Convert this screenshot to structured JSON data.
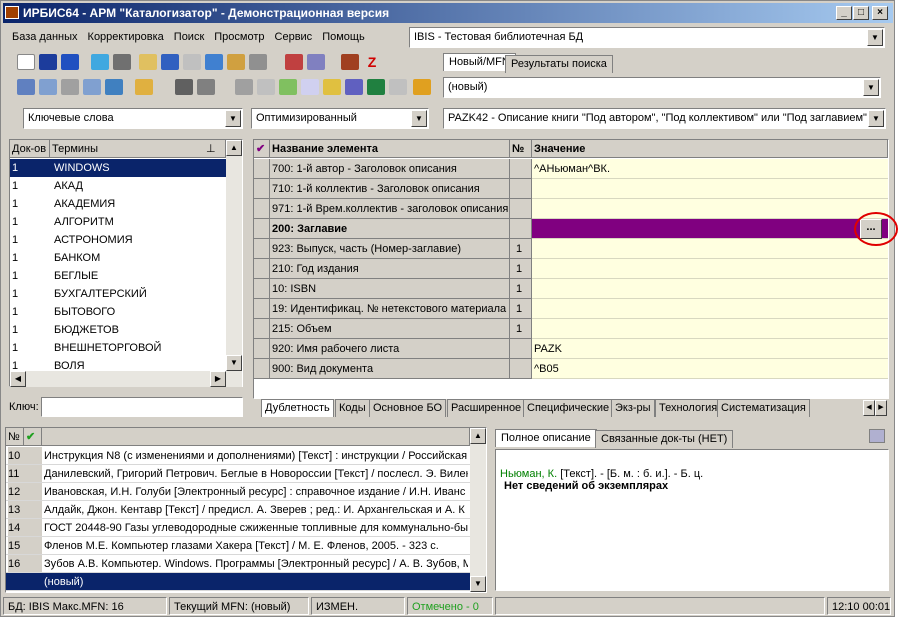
{
  "title": "ИРБИС64 - АРМ \"Каталогизатор\" - Демонстрационная версия",
  "menu": [
    "База данных",
    "Корректировка",
    "Поиск",
    "Просмотр",
    "Сервис",
    "Помощь"
  ],
  "db_combo": "IBIS - Тестовая библиотечная БД",
  "search_tabs": [
    "Новый/MFN",
    "Результаты поиска"
  ],
  "new_combo": "(новый)",
  "keyword_combo": "Ключевые слова",
  "opt_combo": "Оптимизированный",
  "ws_combo": "PAZK42 - Описание книги \"Под автором\", \"Под коллективом\" или \"Под заглавием\"",
  "dict": {
    "col_docs": "Док-ов",
    "col_terms": "Термины",
    "key_label": "Ключ:",
    "rows": [
      {
        "n": "1",
        "t": "WINDOWS"
      },
      {
        "n": "1",
        "t": "АКАД"
      },
      {
        "n": "1",
        "t": "АКАДЕМИЯ"
      },
      {
        "n": "1",
        "t": "АЛГОРИТМ"
      },
      {
        "n": "1",
        "t": "АСТРОНОМИЯ"
      },
      {
        "n": "1",
        "t": "БАНКОМ"
      },
      {
        "n": "1",
        "t": "БЕГЛЫЕ"
      },
      {
        "n": "1",
        "t": "БУХГАЛТЕРСКИЙ"
      },
      {
        "n": "1",
        "t": "БЫТОВОГО"
      },
      {
        "n": "1",
        "t": "БЮДЖЕТОВ"
      },
      {
        "n": "1",
        "t": "ВНЕШНЕТОРГОВОЙ"
      },
      {
        "n": "1",
        "t": "ВОЛЯ"
      }
    ]
  },
  "grid": {
    "col_name": "Название элемента",
    "col_no": "№",
    "col_value": "Значение",
    "check": "✔",
    "rows": [
      {
        "name": "700: 1-й  автор - Заголовок описания",
        "no": "",
        "value": "^AНьюман^BК.",
        "bold": false
      },
      {
        "name": "710: 1-й коллектив - Заголовок описания",
        "no": "",
        "value": "",
        "bold": false
      },
      {
        "name": "971: 1-й Врем.коллектив - заголовок описания",
        "no": "",
        "value": "",
        "bold": false
      },
      {
        "name": "200: Заглавие",
        "no": "",
        "value": "",
        "bold": true
      },
      {
        "name": "923: Выпуск, часть (Номер-заглавие)",
        "no": "1",
        "value": "",
        "bold": false
      },
      {
        "name": "210: Год издания",
        "no": "1",
        "value": "",
        "bold": false
      },
      {
        "name": "10: ISBN",
        "no": "1",
        "value": "",
        "bold": false
      },
      {
        "name": "19: Идентификац. № нетекстового материала",
        "no": "1",
        "value": "",
        "bold": false
      },
      {
        "name": "215: Объем",
        "no": "1",
        "value": "",
        "bold": false
      },
      {
        "name": "920: Имя рабочего листа",
        "no": "",
        "value": "PAZK",
        "bold": false
      },
      {
        "name": "900: Вид документа",
        "no": "",
        "value": "^B05",
        "bold": false
      }
    ],
    "ellipsis": "..."
  },
  "bottom_tabs": [
    "Дублетность",
    "Коды",
    "Основное БО",
    "Расширенное",
    "Специфические",
    "Экз-ры",
    "Технология",
    "Систематизация"
  ],
  "records": {
    "col_no": "№",
    "check": "✔",
    "rows": [
      {
        "n": "10",
        "t": "Инструкция N8   (с изменениями и дополнениями) [Текст] : инструкции / Российская"
      },
      {
        "n": "11",
        "t": "Данилевский, Григорий Петрович. Беглые в Новороссии [Текст] / послесл. Э. Вилен"
      },
      {
        "n": "12",
        "t": "Ивановская, И.Н. Голуби [Электронный ресурс] : справочное издание / И.Н. Иванс"
      },
      {
        "n": "13",
        "t": "Алдайк, Джон. Кентавр [Текст] / предисл. А. Зверев ; ред.: И. Архангельская и А. К"
      },
      {
        "n": "14",
        "t": "ГОСТ 20448-90 Газы углеводородные сжиженные топливные для коммунально-быт"
      },
      {
        "n": "15",
        "t": "Фленов М.Е. Компьютер глазами Хакера [Текст] / М. Е. Фленов, 2005. - 323 с."
      },
      {
        "n": "16",
        "t": "Зубов А.В. Компьютер. Windows. Программы [Электронный ресурс] / А. В. Зубов, М"
      },
      {
        "n": "",
        "t": "(новый)"
      }
    ]
  },
  "desc_tabs": [
    "Полное описание",
    "Связанные док-ты (НЕТ)"
  ],
  "desc": {
    "author": "Ньюман, К.",
    "rest": "  [Текст]. - [Б. м. : б. и.]. - Б. ц.",
    "copies": "Нет сведений об экземплярах"
  },
  "status": {
    "db": "БД: IBIS Макс.MFN: 16",
    "mfn": "Текущий MFN: (новый)",
    "changed": "ИЗМЕН.",
    "marked": "Отмечено - 0",
    "time": "12:10",
    "time2": "00:01"
  }
}
